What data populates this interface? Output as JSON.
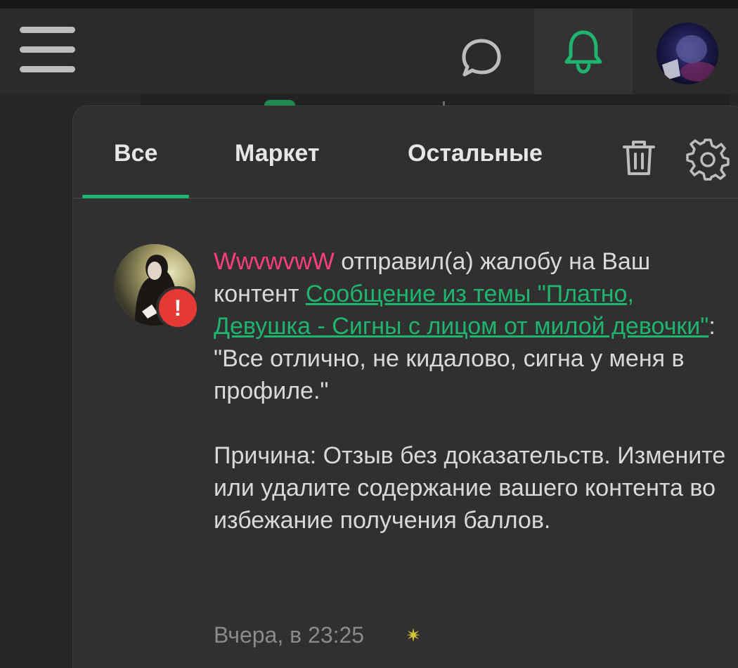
{
  "header": {
    "menu_icon": "hamburger-icon",
    "chat_icon": "chat-bubble-icon",
    "bell_icon": "bell-icon",
    "accent_color": "#1fb56f"
  },
  "notifications": {
    "tabs": [
      {
        "label": "Все",
        "active": true
      },
      {
        "label": "Маркет",
        "active": false
      },
      {
        "label": "Остальные",
        "active": false
      }
    ],
    "trash_icon": "trash-icon",
    "settings_icon": "gear-icon",
    "item": {
      "username": "WwvwvwW",
      "action": " отправил(а) жалобу на Ваш контент ",
      "link_text": "Сообщение из темы \"Платно, Девушка - Сигны с лицом от милой девочки\"",
      "after_link": ":",
      "quote": "\"Все отлично, не кидалово, сигна у меня в профиле.\"",
      "reason": "Причина: Отзыв без доказательств. Измените или удалите содержание вашего контента во избежание получения баллов.",
      "time": "Вчера, в 23:25",
      "badge": "!",
      "username_color": "#ff3d7f",
      "badge_color": "#e53935"
    }
  }
}
